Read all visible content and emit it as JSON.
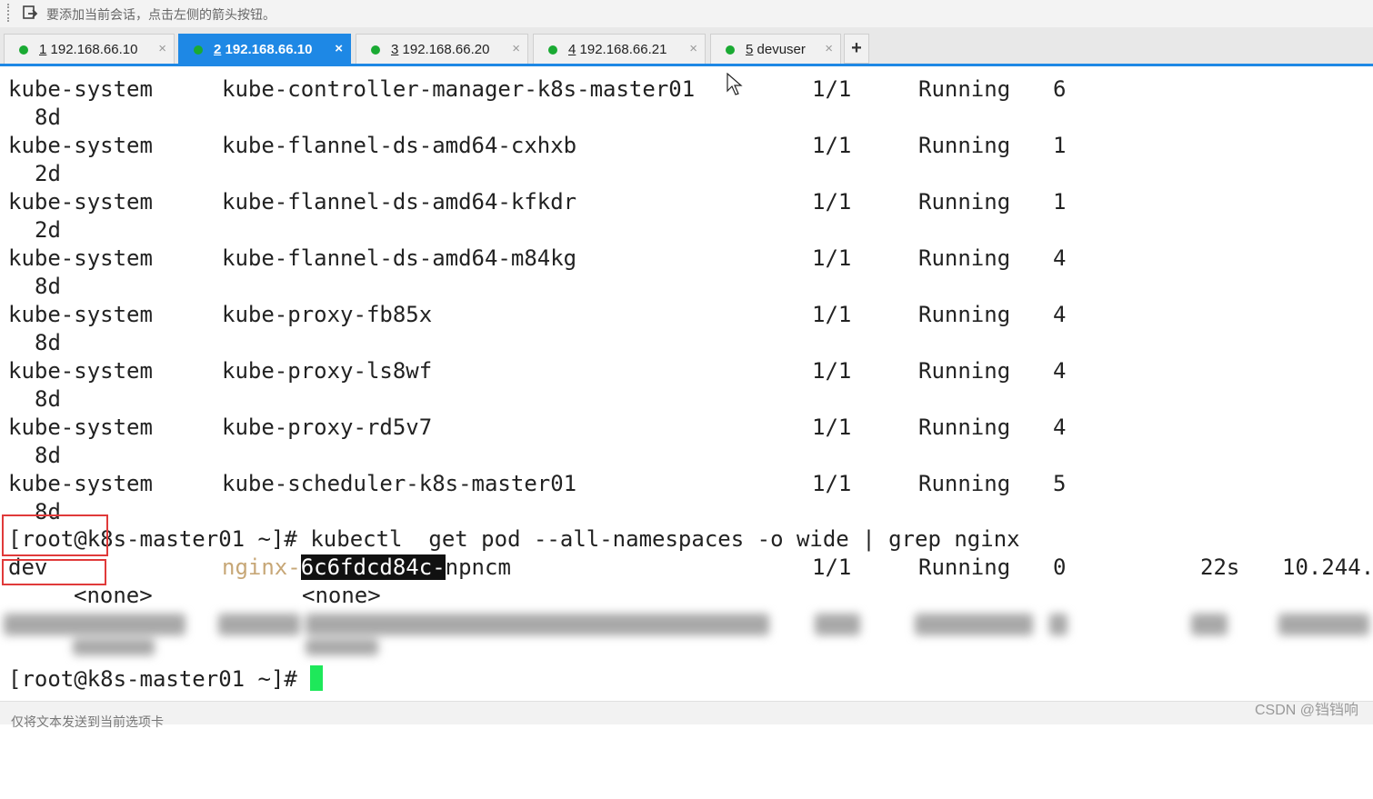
{
  "hint_bar": {
    "text": "要添加当前会话，点击左侧的箭头按钮。",
    "icon": "arrow-into-box-icon"
  },
  "tabs": [
    {
      "num": "1",
      "label": "192.168.66.10",
      "active": false,
      "status_color": "#1aaa33"
    },
    {
      "num": "2",
      "label": "192.168.66.10",
      "active": true,
      "status_color": "#1aaa33"
    },
    {
      "num": "3",
      "label": "192.168.66.20",
      "active": false,
      "status_color": "#1aaa33"
    },
    {
      "num": "4",
      "label": "192.168.66.21",
      "active": false,
      "status_color": "#1aaa33"
    },
    {
      "num": "5",
      "label": "devuser",
      "active": false,
      "status_color": "#1aaa33"
    }
  ],
  "tab_close": "×",
  "add_tab": "+",
  "terminal": {
    "rows": [
      {
        "ns": "kube-system",
        "name": "kube-controller-manager-k8s-master01",
        "ready": "1/1",
        "status": "Running",
        "restarts": "6",
        "age": "8d"
      },
      {
        "ns": "kube-system",
        "name": "kube-flannel-ds-amd64-cxhxb",
        "ready": "1/1",
        "status": "Running",
        "restarts": "1",
        "age": "2d"
      },
      {
        "ns": "kube-system",
        "name": "kube-flannel-ds-amd64-kfkdr",
        "ready": "1/1",
        "status": "Running",
        "restarts": "1",
        "age": "2d"
      },
      {
        "ns": "kube-system",
        "name": "kube-flannel-ds-amd64-m84kg",
        "ready": "1/1",
        "status": "Running",
        "restarts": "4",
        "age": "8d"
      },
      {
        "ns": "kube-system",
        "name": "kube-proxy-fb85x",
        "ready": "1/1",
        "status": "Running",
        "restarts": "4",
        "age": "8d"
      },
      {
        "ns": "kube-system",
        "name": "kube-proxy-ls8wf",
        "ready": "1/1",
        "status": "Running",
        "restarts": "4",
        "age": "8d"
      },
      {
        "ns": "kube-system",
        "name": "kube-proxy-rd5v7",
        "ready": "1/1",
        "status": "Running",
        "restarts": "4",
        "age": "8d"
      },
      {
        "ns": "kube-system",
        "name": "kube-scheduler-k8s-master01",
        "ready": "1/1",
        "status": "Running",
        "restarts": "5",
        "age": "8d"
      }
    ],
    "prompt": "[root@k8s-master01 ~]#",
    "command": " kubectl  get pod --all-namespaces -o wide | grep nginx",
    "result": {
      "ns": "dev",
      "name_prefix": "nginx",
      "name_dash": "-",
      "name_highlight": "6c6fdcd84c-",
      "name_suffix": "npncm",
      "ready": "1/1",
      "status": "Running",
      "restarts": "0",
      "age": "22s",
      "ip": "10.244.",
      "nominated": "<none>",
      "readiness": "<none>"
    },
    "final_prompt": "[root@k8s-master01 ~]#"
  },
  "status_bar": {
    "text": "仅将文本发送到当前选项卡"
  },
  "watermark": "CSDN @铛铛响"
}
